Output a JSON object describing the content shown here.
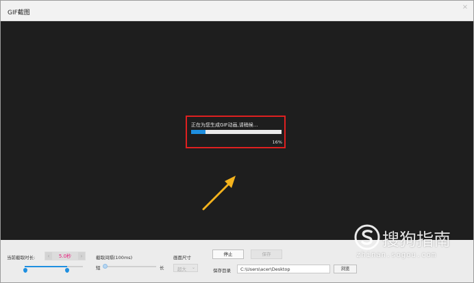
{
  "window": {
    "title": "GIF截图",
    "close_glyph": "×"
  },
  "progress": {
    "message": "正在为您生成GIF动画,请稍候...",
    "percent_label": "16%",
    "value": 0.16,
    "highlight_color": "#e02020",
    "fill_color": "#1e8fe0"
  },
  "annotation": {
    "arrow_color": "#f4b31d"
  },
  "controls": {
    "duration_label": "当前截取时长:",
    "duration_value": "5.0秒",
    "duration_prev_glyph": "‹",
    "duration_next_glyph": "›",
    "interval_label": "截取间隔(100ms)",
    "interval_short": "短",
    "interval_long": "长",
    "size_label": "画面尺寸",
    "size_value": "超大",
    "size_chevron": "⌄",
    "stop_button": "停止",
    "save_button": "保存",
    "save_dir_label": "保存目录",
    "save_dir_value": "C:\\Users\\acer\\Desktop",
    "browse_button": "浏览"
  },
  "watermark": {
    "brand": "搜狗指南",
    "url": "zhinan.sogou.com",
    "logo_icon": "sogou-logo-icon"
  }
}
